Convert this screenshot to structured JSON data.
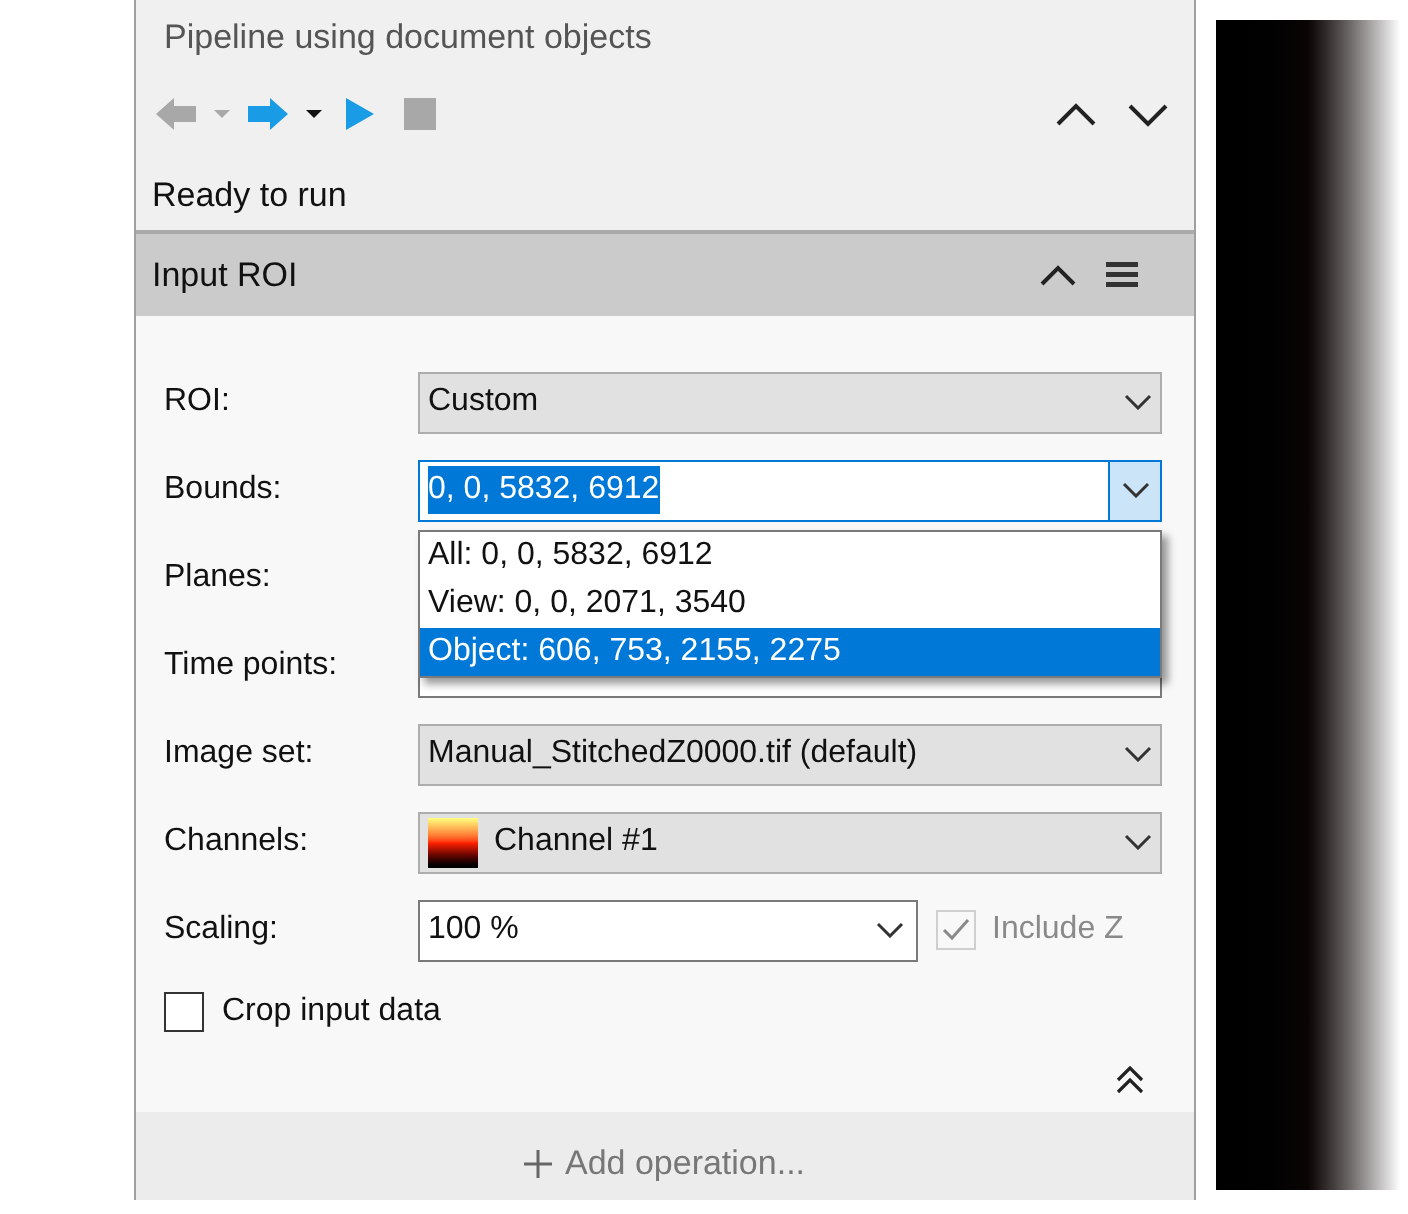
{
  "title": "Pipeline using document objects",
  "toolbar": [
    {
      "kind": "back",
      "disabled": true
    },
    {
      "kind": "menu",
      "disabled": true
    },
    {
      "kind": "forward",
      "disabled": false
    },
    {
      "kind": "menu",
      "disabled": false
    },
    {
      "kind": "run",
      "disabled": false
    },
    {
      "kind": "stop",
      "disabled": true
    }
  ],
  "nav": [
    {
      "kind": "up"
    },
    {
      "kind": "down"
    }
  ],
  "status": "Ready to run",
  "section": {
    "title": "Input ROI",
    "fields": [
      {
        "kind": "combo",
        "label": "ROI:",
        "value": "Custom"
      },
      {
        "kind": "edit_combo",
        "label": "Bounds:",
        "value": "0, 0, 5832, 6912",
        "focused": true,
        "options": [
          {
            "text": "All: 0, 0, 5832, 6912",
            "selected": false
          },
          {
            "text": "View: 0, 0, 2071, 3540",
            "selected": false
          },
          {
            "text": "Object: 606, 753, 2155, 2275",
            "selected": true
          }
        ]
      },
      {
        "kind": "label_only",
        "label": "Planes:"
      },
      {
        "kind": "covered",
        "label": "Time points:"
      },
      {
        "kind": "combo",
        "label": "Image set:",
        "value": "Manual_StitchedZ0000.tif (default)"
      },
      {
        "kind": "channel_combo",
        "label": "Channels:",
        "value": "Channel #1"
      },
      {
        "kind": "edit_combo",
        "label": "Scaling:",
        "value": "100 %",
        "focused": false,
        "checkbox": {
          "label": "Include Z",
          "checked": true,
          "disabled": true
        }
      },
      {
        "kind": "checkbox",
        "label": "Crop input data",
        "checked": false
      }
    ]
  },
  "add_operation": "Add operation..."
}
